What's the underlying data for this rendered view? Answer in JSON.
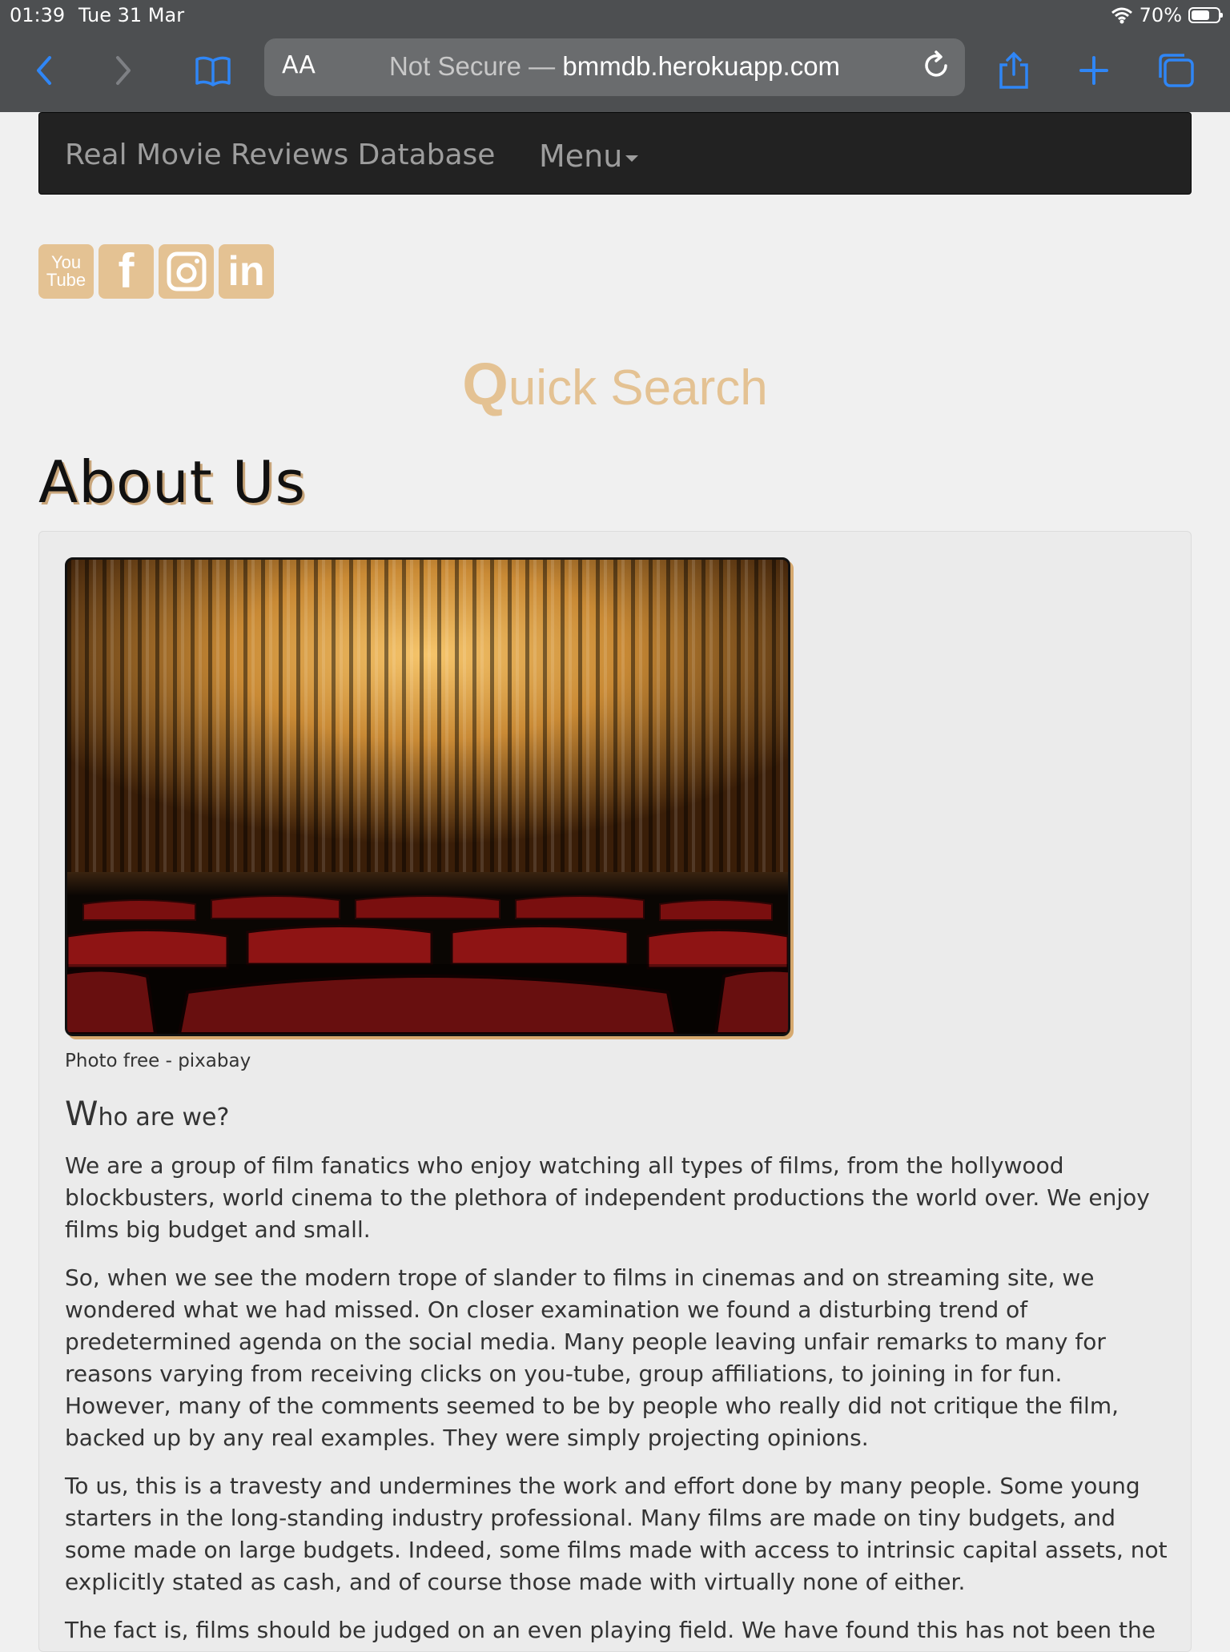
{
  "status": {
    "time": "01:39",
    "date": "Tue 31 Mar",
    "battery": "70%",
    "battery_level": 0.7
  },
  "browser": {
    "text_size_label": "AA",
    "not_secure": "Not Secure —",
    "domain": "bmmdb.herokuapp.com",
    "icons": [
      "back-icon",
      "forward-icon",
      "bookmarks-icon",
      "reload-icon",
      "share-icon",
      "new-tab-icon",
      "tabs-icon"
    ]
  },
  "navbar": {
    "brand": "Real Movie Reviews Database",
    "menu": "Menu"
  },
  "social": {
    "youtube_top": "You",
    "youtube_bottom": "Tube",
    "facebook": "f",
    "linkedin": "in"
  },
  "colors": {
    "accent": "#e4c293",
    "navbar": "#222222",
    "chrome": "#4d4f51",
    "link": "#2f86f6"
  },
  "quick_search": {
    "first_letter": "Q",
    "rest": "uick Search"
  },
  "page_title": "About Us",
  "photo": {
    "caption": "Photo free - pixabay"
  },
  "who": {
    "first_letter": "W",
    "rest": "ho are we?"
  },
  "paragraphs": [
    "We are a group of film fanatics who enjoy watching all types of films, from the hollywood blockbusters, world cinema to the plethora of independent productions the world over. We enjoy films big budget and small.",
    "So, when we see the modern trope of slander to films in cinemas and on streaming site, we wondered what we had missed. On closer examination we found a disturbing trend of predetermined agenda on the social media. Many people leaving unfair remarks to many for reasons varying from receiving clicks on you-tube, group affiliations, to joining in for fun. However, many of the comments seemed to be by people who really did not critique the film, backed up by any real examples. They were simply projecting opinions.",
    "To us, this is a travesty and undermines the work and effort done by many people. Some young starters in the long-standing industry professional. Many films are made on tiny budgets, and some made on large budgets. Indeed, some films made with access to intrinsic capital assets, not explicitly stated as cash, and of course those made with virtually none of either.",
    "The fact is, films should be judged on an even playing field. We have found this has not been the"
  ]
}
